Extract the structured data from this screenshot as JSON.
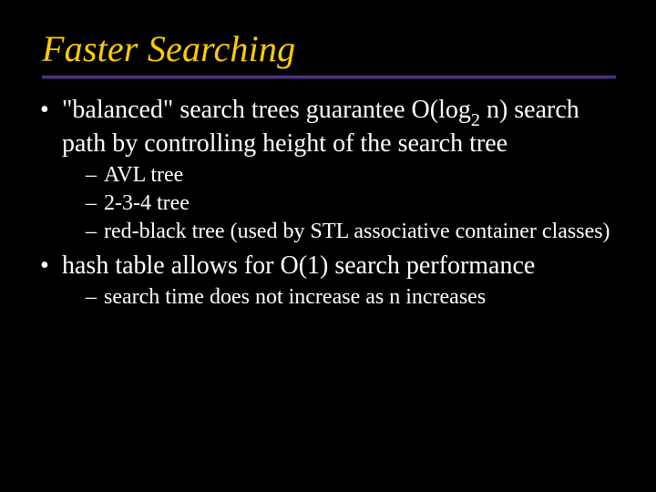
{
  "title": "Faster Searching",
  "b1": {
    "pre": "\"balanced\" search trees guarantee O(log",
    "sub": "2",
    "post": " n) search path by controlling height of the search tree",
    "s1": "AVL tree",
    "s2": "2-3-4 tree",
    "s3": "red-black tree (used by STL associative container classes)"
  },
  "b2": {
    "text": "hash table allows for O(1) search performance",
    "s1": "search time does not increase as n increases"
  }
}
